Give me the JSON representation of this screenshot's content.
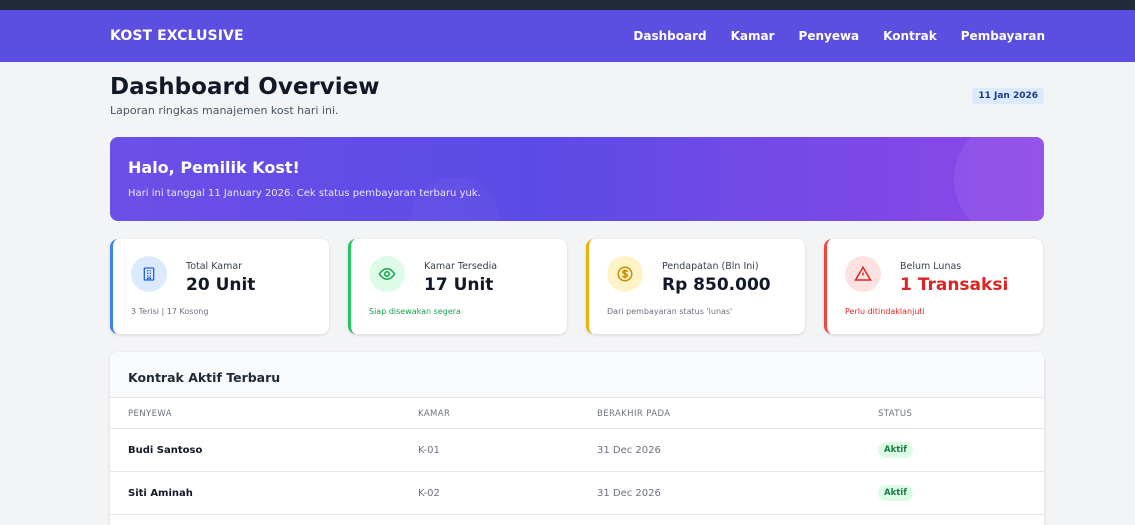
{
  "app": {
    "brand": "KOST EXCLUSIVE"
  },
  "nav": [
    "Dashboard",
    "Kamar",
    "Penyewa",
    "Kontrak",
    "Pembayaran"
  ],
  "header": {
    "title": "Dashboard Overview",
    "subtitle": "Laporan ringkas manajemen kost hari ini.",
    "date": "11 Jan 2026"
  },
  "hero": {
    "greeting": "Halo, Pemilik Kost!",
    "message": "Hari ini tanggal 11 January 2026. Cek status pembayaran terbaru yuk."
  },
  "stats": [
    {
      "label": "Total Kamar",
      "value": "20 Unit",
      "note": "3 Terisi | 17 Kosong",
      "icon": "building-icon",
      "accent": "#3b82f6"
    },
    {
      "label": "Kamar Tersedia",
      "value": "17 Unit",
      "note": "Siap disewakan segera",
      "icon": "eye-icon",
      "accent": "#22c55e"
    },
    {
      "label": "Pendapatan (Bln Ini)",
      "value": "Rp 850.000",
      "note": "Dari pembayaran status 'lunas'",
      "icon": "coin-icon",
      "accent": "#eab308"
    },
    {
      "label": "Belum Lunas",
      "value": "1 Transaksi",
      "note": "Perlu ditindaklanjuti",
      "icon": "warning-icon",
      "accent": "#ef4444"
    }
  ],
  "contracts": {
    "title": "Kontrak Aktif Terbaru",
    "columns": [
      "PENYEWA",
      "KAMAR",
      "BERAKHIR PADA",
      "STATUS"
    ],
    "rows": [
      {
        "tenant": "Budi Santoso",
        "room": "K-01",
        "end": "31 Dec 2026",
        "status": "Aktif"
      },
      {
        "tenant": "Siti Aminah",
        "room": "K-02",
        "end": "31 Dec 2026",
        "status": "Aktif"
      }
    ]
  }
}
